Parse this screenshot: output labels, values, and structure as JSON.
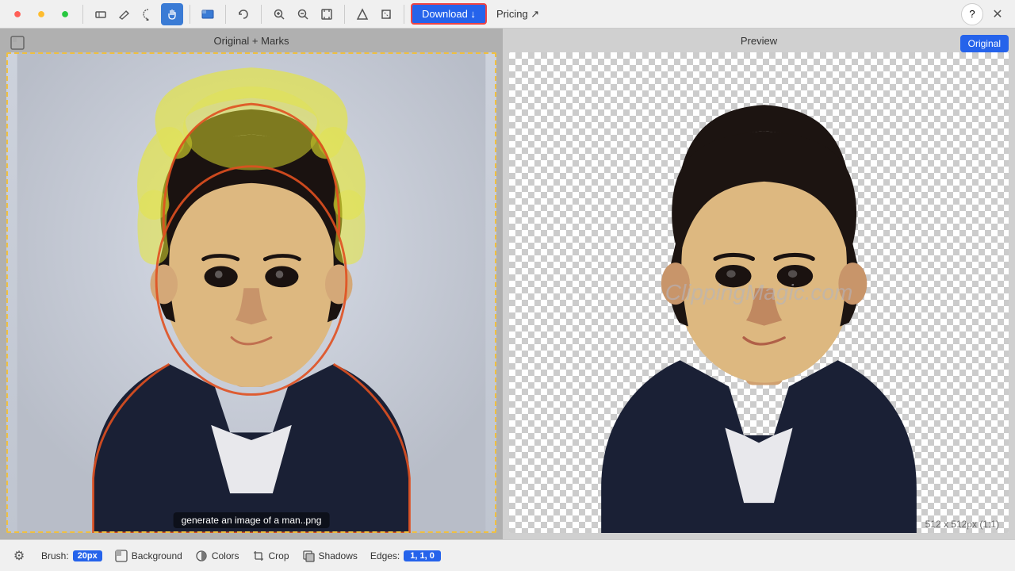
{
  "toolbar": {
    "traffic_red": "●",
    "traffic_yellow": "●",
    "traffic_green": "●",
    "undo_icon": "↩",
    "redo_icon": "↻",
    "zoom_in_icon": "⊕",
    "zoom_out_icon": "⊖",
    "fit_icon": "⤢",
    "triangle_icon": "△",
    "square_icon": "□",
    "selection_icon": "⬚",
    "download_label": "Download ↓",
    "pricing_label": "Pricing ↗",
    "help_label": "?",
    "close_label": "✕"
  },
  "left_panel": {
    "title": "Original + Marks",
    "filename": "generate an image of a man..png"
  },
  "right_panel": {
    "title": "Preview",
    "original_btn": "Original",
    "image_size": "512 x 512px (1:1)",
    "watermark": "ClippingMagic.com"
  },
  "bottom_toolbar": {
    "gear_icon": "⚙",
    "brush_label": "Brush:",
    "brush_size": "20px",
    "background_icon": "□",
    "background_label": "Background",
    "colors_icon": "◑",
    "colors_label": "Colors",
    "crop_icon": "⊞",
    "crop_label": "Crop",
    "shadows_icon": "□",
    "shadows_label": "Shadows",
    "edges_label": "Edges:",
    "edges_value": "1, 1, 0"
  }
}
